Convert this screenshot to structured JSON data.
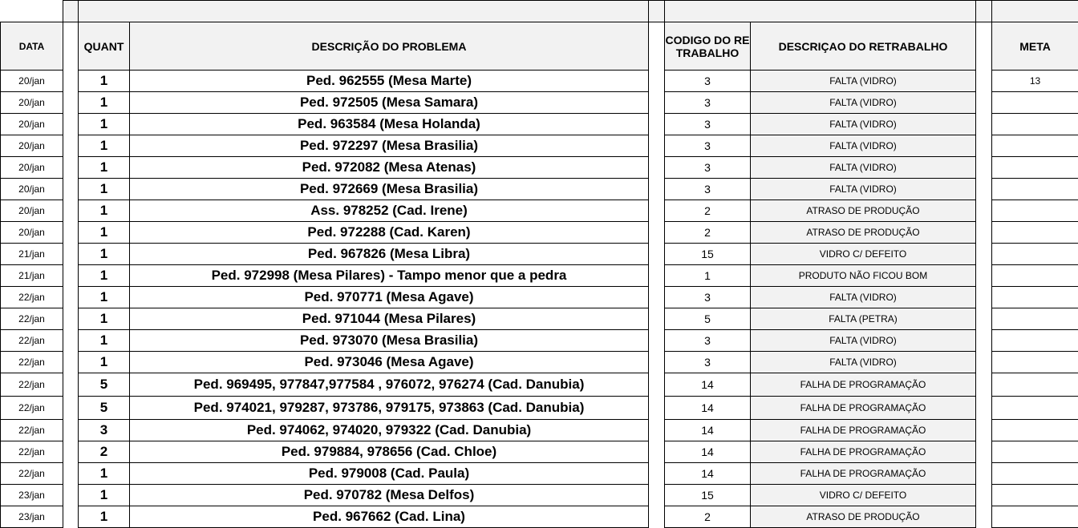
{
  "headers": {
    "date": "DATA",
    "quant": "QUANT",
    "problem": "DESCRIÇÃO DO PROBLEMA",
    "code": "CODIGO DO RETRABALHO",
    "rework": "DESCRIÇAO DO RETRABALHO",
    "meta": "META"
  },
  "rows": [
    {
      "date": "20/jan",
      "qty": "1",
      "desc": "Ped. 962555 (Mesa Marte)",
      "code": "3",
      "rework": "FALTA (VIDRO)",
      "meta": "13"
    },
    {
      "date": "20/jan",
      "qty": "1",
      "desc": "Ped. 972505 (Mesa Samara)",
      "code": "3",
      "rework": "FALTA (VIDRO)",
      "meta": ""
    },
    {
      "date": "20/jan",
      "qty": "1",
      "desc": "Ped. 963584 (Mesa Holanda)",
      "code": "3",
      "rework": "FALTA (VIDRO)",
      "meta": ""
    },
    {
      "date": "20/jan",
      "qty": "1",
      "desc": "Ped. 972297 (Mesa Brasilia)",
      "code": "3",
      "rework": "FALTA (VIDRO)",
      "meta": ""
    },
    {
      "date": "20/jan",
      "qty": "1",
      "desc": "Ped. 972082 (Mesa Atenas)",
      "code": "3",
      "rework": "FALTA (VIDRO)",
      "meta": ""
    },
    {
      "date": "20/jan",
      "qty": "1",
      "desc": "Ped. 972669 (Mesa Brasilia)",
      "code": "3",
      "rework": "FALTA (VIDRO)",
      "meta": ""
    },
    {
      "date": "20/jan",
      "qty": "1",
      "desc": "Ass. 978252 (Cad. Irene)",
      "code": "2",
      "rework": "ATRASO DE PRODUÇÃO",
      "meta": ""
    },
    {
      "date": "20/jan",
      "qty": "1",
      "desc": "Ped. 972288 (Cad. Karen)",
      "code": "2",
      "rework": "ATRASO DE PRODUÇÃO",
      "meta": ""
    },
    {
      "date": "21/jan",
      "qty": "1",
      "desc": "Ped. 967826 (Mesa Libra)",
      "code": "15",
      "rework": "VIDRO C/ DEFEITO",
      "meta": ""
    },
    {
      "date": "21/jan",
      "qty": "1",
      "desc": "Ped. 972998 (Mesa Pilares) - Tampo menor que a pedra",
      "code": "1",
      "rework": "PRODUTO NÃO FICOU BOM",
      "meta": ""
    },
    {
      "date": "22/jan",
      "qty": "1",
      "desc": "Ped. 970771 (Mesa Agave)",
      "code": "3",
      "rework": "FALTA (VIDRO)",
      "meta": ""
    },
    {
      "date": "22/jan",
      "qty": "1",
      "desc": "Ped. 971044 (Mesa Pilares)",
      "code": "5",
      "rework": "FALTA (PETRA)",
      "meta": ""
    },
    {
      "date": "22/jan",
      "qty": "1",
      "desc": "Ped. 973070 (Mesa Brasilia)",
      "code": "3",
      "rework": "FALTA (VIDRO)",
      "meta": ""
    },
    {
      "date": "22/jan",
      "qty": "1",
      "desc": "Ped. 973046 (Mesa Agave)",
      "code": "3",
      "rework": "FALTA (VIDRO)",
      "meta": ""
    },
    {
      "date": "22/jan",
      "qty": "5",
      "desc": "Ped. 969495, 977847,977584 , 976072, 976274 (Cad. Danubia)",
      "code": "14",
      "rework": "FALHA DE PROGRAMAÇÃO",
      "meta": ""
    },
    {
      "date": "22/jan",
      "qty": "5",
      "desc": "Ped. 974021, 979287, 973786, 979175, 973863 (Cad. Danubia)",
      "code": "14",
      "rework": "FALHA DE PROGRAMAÇÃO",
      "meta": ""
    },
    {
      "date": "22/jan",
      "qty": "3",
      "desc": "Ped. 974062, 974020, 979322 (Cad. Danubia)",
      "code": "14",
      "rework": "FALHA DE PROGRAMAÇÃO",
      "meta": ""
    },
    {
      "date": "22/jan",
      "qty": "2",
      "desc": "Ped. 979884, 978656 (Cad. Chloe)",
      "code": "14",
      "rework": "FALHA DE PROGRAMAÇÃO",
      "meta": ""
    },
    {
      "date": "22/jan",
      "qty": "1",
      "desc": "Ped. 979008 (Cad. Paula)",
      "code": "14",
      "rework": "FALHA DE PROGRAMAÇÃO",
      "meta": ""
    },
    {
      "date": "23/jan",
      "qty": "1",
      "desc": "Ped. 970782 (Mesa Delfos)",
      "code": "15",
      "rework": "VIDRO C/ DEFEITO",
      "meta": ""
    },
    {
      "date": "23/jan",
      "qty": "1",
      "desc": "Ped. 967662 (Cad. Lina)",
      "code": "2",
      "rework": "ATRASO DE PRODUÇÃO",
      "meta": ""
    }
  ]
}
